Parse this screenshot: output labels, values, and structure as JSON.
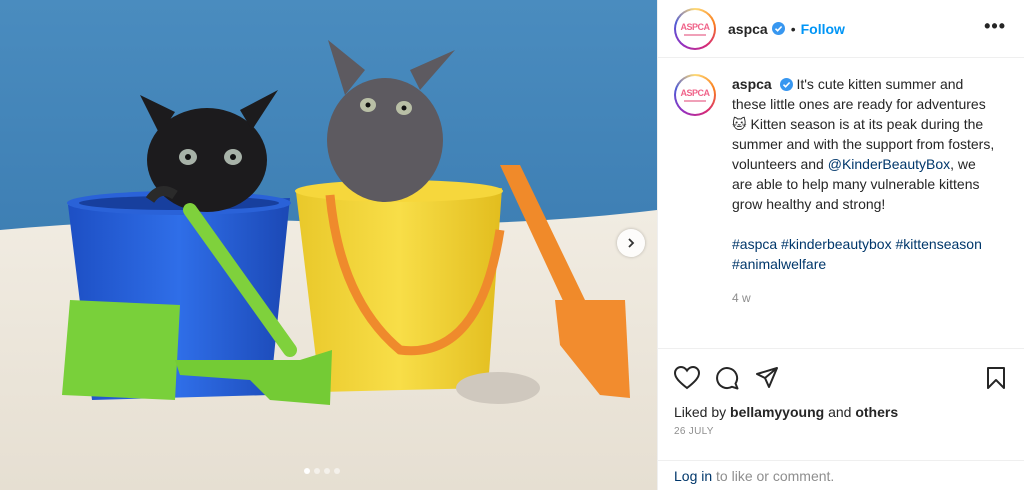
{
  "header": {
    "username": "aspca",
    "bullet": "•",
    "follow_label": "Follow",
    "more_label": "•••",
    "logo_text": "ASPCA"
  },
  "caption": {
    "username": "aspca",
    "text_1": "It's cute kitten summer and these little ones are ready for adventures ",
    "emoji": "🐱",
    "text_2": " Kitten season is at its peak during the summer and with the support from fosters, volunteers and ",
    "mention": "@KinderBeautyBox",
    "text_3": ", we are able to help many vulnerable kittens grow healthy and strong!",
    "hashtags": [
      "#aspca",
      "#kinderbeautybox",
      "#kittenseason",
      "#animalwelfare"
    ],
    "age": "4 w"
  },
  "likes": {
    "prefix": "Liked by ",
    "user": "bellamyyoung",
    "middle": " and ",
    "others": "others"
  },
  "date": "26 JULY",
  "login": {
    "link": "Log in",
    "rest": " to like or comment."
  },
  "carousel": {
    "slides": 4,
    "active": 0
  },
  "colors": {
    "accent": "#0095f6",
    "link": "#00376b",
    "muted": "#8e8e8e",
    "verified": "#3897f0"
  },
  "icons": [
    "verified-icon",
    "more-icon",
    "next-arrow-icon",
    "heart-icon",
    "comment-icon",
    "share-icon",
    "bookmark-icon"
  ]
}
